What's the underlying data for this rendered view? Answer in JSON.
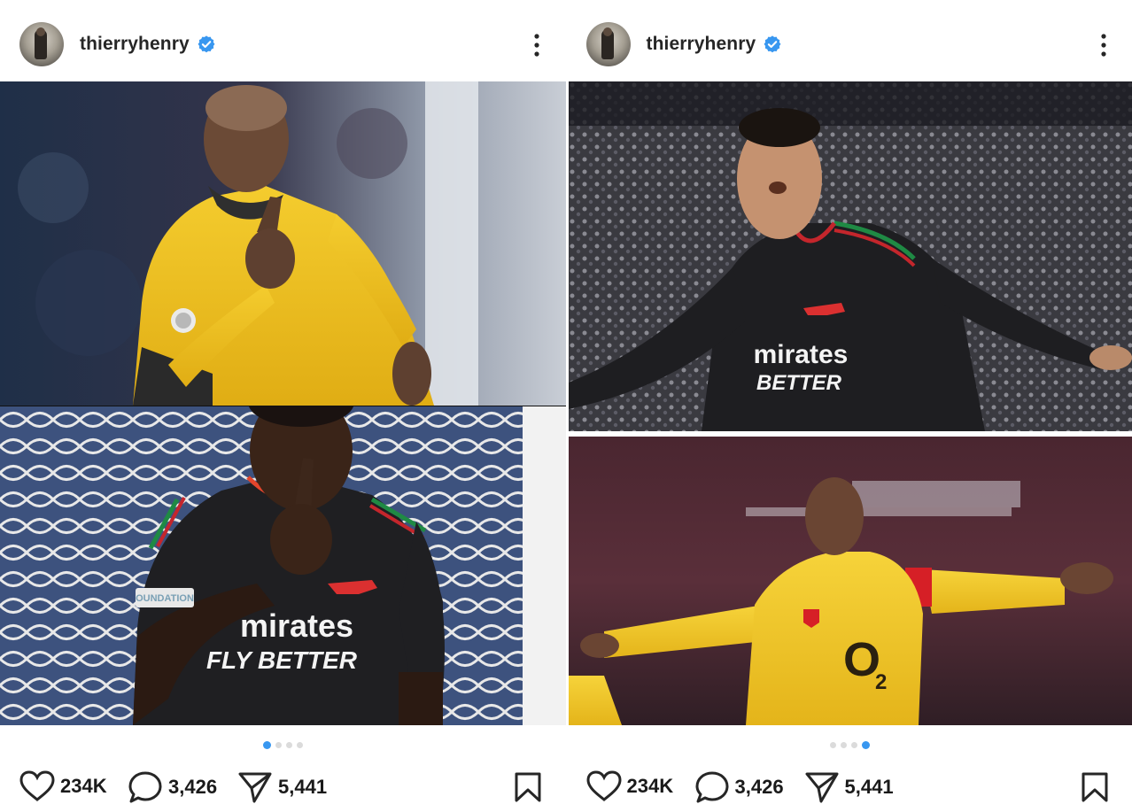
{
  "posts": [
    {
      "username": "thierryhenry",
      "verified_icon": "verified-badge-icon",
      "more_icon": "more-vertical-icon",
      "panels": [
        {
          "label_line1": "",
          "label_line2": ""
        },
        {
          "label_line1": "mirates",
          "label_line2": "FLY BETTER",
          "sleeve_text": "OUNDATION"
        }
      ],
      "carousel": {
        "count": 4,
        "active": 1
      },
      "actions": {
        "likes": "234K",
        "comments": "3,426",
        "shares": "5,441"
      }
    },
    {
      "username": "thierryhenry",
      "verified_icon": "verified-badge-icon",
      "more_icon": "more-vertical-icon",
      "panels": [
        {
          "label_line1": "mirates",
          "label_line2": "BETTER"
        },
        {
          "label_line1": "O",
          "label_line2": "2"
        }
      ],
      "carousel": {
        "count": 4,
        "active": 4
      },
      "actions": {
        "likes": "234K",
        "comments": "3,426",
        "shares": "5,441"
      }
    }
  ],
  "colors": {
    "verified_blue": "#3897f0",
    "active_dot": "#3897f0",
    "inactive_dot": "#dbdbdb",
    "arsenal_yellow": "#f1c21b",
    "arsenal_dark_kit": "#1d1d1f",
    "arsenal_red": "#d61f26"
  }
}
